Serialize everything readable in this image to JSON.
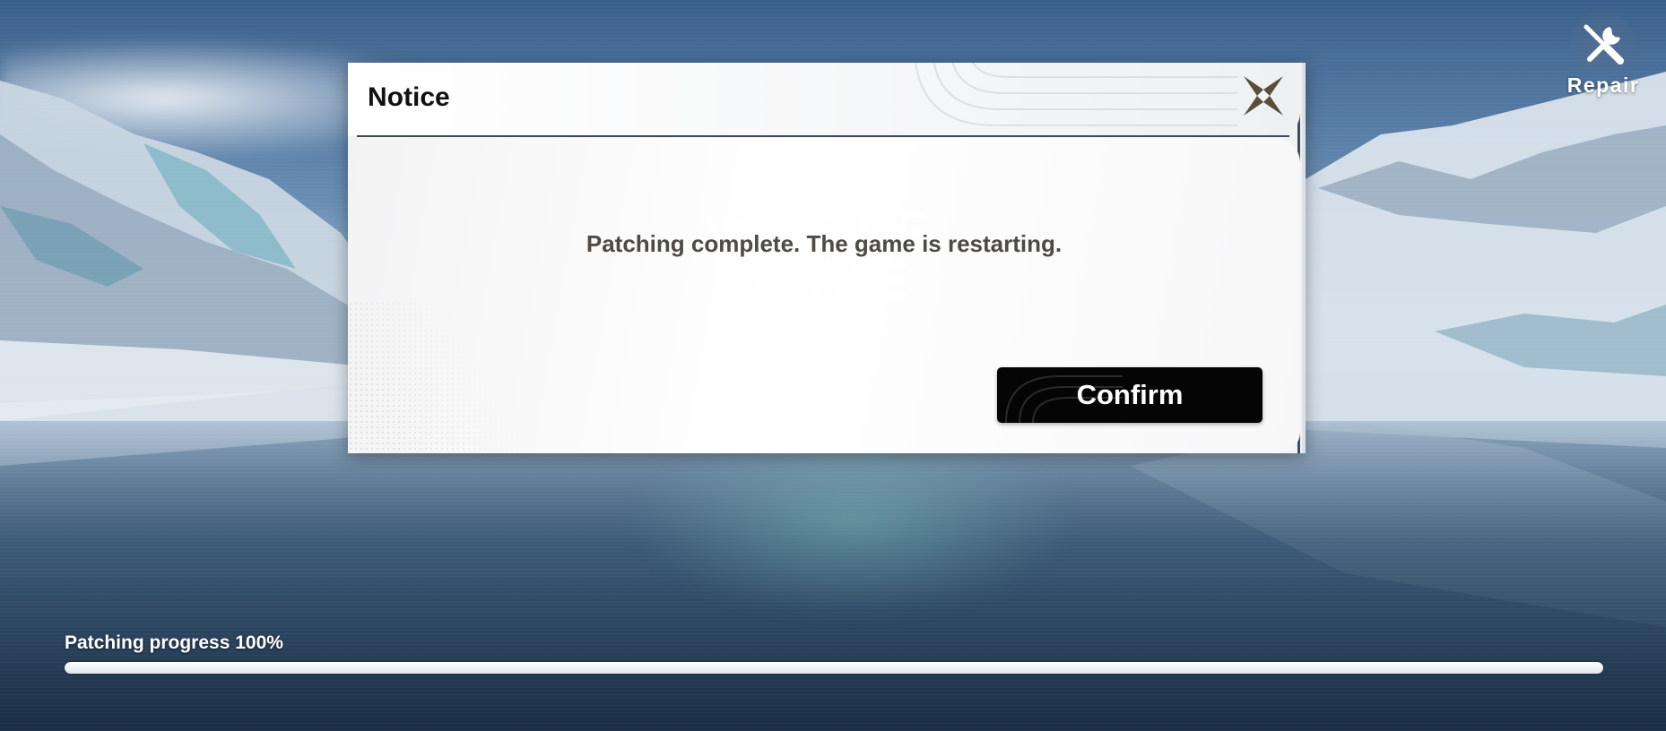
{
  "repair": {
    "label": "Repair",
    "icon": "wrench-screwdriver-icon"
  },
  "dialog": {
    "title": "Notice",
    "close_icon": "close-icon",
    "message": "Patching complete. The game is restarting.",
    "confirm_label": "Confirm"
  },
  "progress": {
    "label": "Patching progress 100%",
    "value": 1.0
  },
  "colors": {
    "button_bg": "#050505",
    "message_text": "#4e4a45",
    "divider": "#3d4a5c"
  }
}
